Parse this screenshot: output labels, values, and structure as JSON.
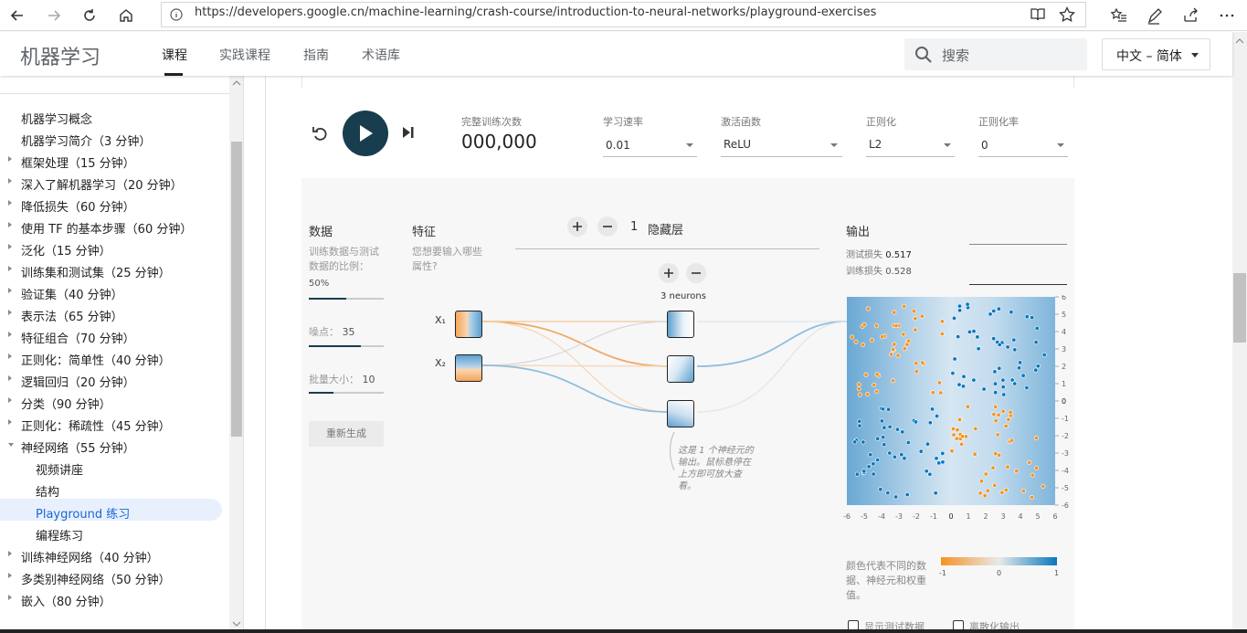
{
  "browser": {
    "url": "https://developers.google.cn/machine-learning/crash-course/introduction-to-neural-networks/playground-exercises"
  },
  "header": {
    "site_title": "机器学习",
    "tabs": [
      "课程",
      "实践课程",
      "指南",
      "术语库"
    ],
    "search_placeholder": "搜索",
    "language": "中文 – 简体"
  },
  "sidebar": {
    "items": [
      {
        "label": "机器学习概念",
        "arrow": false
      },
      {
        "label": "机器学习简介（3 分钟）",
        "arrow": false
      },
      {
        "label": "框架处理（15 分钟）",
        "arrow": true
      },
      {
        "label": "深入了解机器学习（20 分钟）",
        "arrow": true
      },
      {
        "label": "降低损失（60 分钟）",
        "arrow": true
      },
      {
        "label": "使用 TF 的基本步骤（60 分钟）",
        "arrow": true
      },
      {
        "label": "泛化（15 分钟）",
        "arrow": true
      },
      {
        "label": "训练集和测试集（25 分钟）",
        "arrow": true
      },
      {
        "label": "验证集（40 分钟）",
        "arrow": true
      },
      {
        "label": "表示法（65 分钟）",
        "arrow": true
      },
      {
        "label": "特征组合（70 分钟）",
        "arrow": true
      },
      {
        "label": "正则化：简单性（40 分钟）",
        "arrow": true
      },
      {
        "label": "逻辑回归（20 分钟）",
        "arrow": true
      },
      {
        "label": "分类（90 分钟）",
        "arrow": true
      },
      {
        "label": "正则化：稀疏性（45 分钟）",
        "arrow": true
      },
      {
        "label": "神经网络（55 分钟）",
        "arrow": true,
        "expanded": true
      },
      {
        "label": "视频讲座",
        "sub": true
      },
      {
        "label": "结构",
        "sub": true
      },
      {
        "label": "Playground 练习",
        "sub": true,
        "active": true
      },
      {
        "label": "编程练习",
        "sub": true
      },
      {
        "label": "训练神经网络（40 分钟）",
        "arrow": true
      },
      {
        "label": "多类别神经网络（50 分钟）",
        "arrow": true
      },
      {
        "label": "嵌入（80 分钟）",
        "arrow": true
      }
    ]
  },
  "playground": {
    "epoch_label": "完整训练次数",
    "epoch_value": "000,000",
    "learning_rate": {
      "label": "学习速率",
      "value": "0.01"
    },
    "activation": {
      "label": "激活函数",
      "value": "ReLU"
    },
    "regularization": {
      "label": "正则化",
      "value": "L2"
    },
    "reg_rate": {
      "label": "正则化率",
      "value": "0"
    },
    "data": {
      "title": "数据",
      "ratio_text": "训练数据与测试数据的比例：",
      "ratio_value": "50%",
      "ratio_fraction": 0.5,
      "noise_label": "噪点：",
      "noise_value": "35",
      "noise_fraction": 0.7,
      "batch_label": "批量大小：",
      "batch_value": "10",
      "batch_fraction": 0.33,
      "regenerate": "重新生成"
    },
    "features": {
      "title": "特征",
      "desc": "您想要输入哪些属性?",
      "x1": "X₁",
      "x2": "X₂"
    },
    "hidden": {
      "count": "1",
      "label": "隐藏层",
      "neurons_label": "3 neurons"
    },
    "tooltip": "这是 1 个神经元的输出。鼠标悬停在上方即可放大查看。",
    "output": {
      "title": "输出",
      "test_loss_label": "测试损失",
      "test_loss": "0.517",
      "train_loss_label": "训练损失",
      "train_loss": "0.528",
      "y_ticks": [
        "6",
        "5",
        "4",
        "3",
        "2",
        "1",
        "0",
        "-1",
        "-2",
        "-3",
        "-4",
        "-5",
        "-6"
      ],
      "x_ticks": [
        "-6",
        "-5",
        "-4",
        "-3",
        "-2",
        "-1",
        "0",
        "1",
        "2",
        "3",
        "4",
        "5",
        "6"
      ],
      "color_legend": "颜色代表不同的数据、神经元和权重值。",
      "scale_labels": [
        "-1",
        "0",
        "1"
      ],
      "show_test": "显示测试数据",
      "discretize": "离散化输出"
    }
  },
  "colors": {
    "orange": "#f59322",
    "blue": "#0877bd",
    "dark": "#183d4e",
    "active_bg": "#e8f0fe",
    "active_text": "#1967d2"
  }
}
